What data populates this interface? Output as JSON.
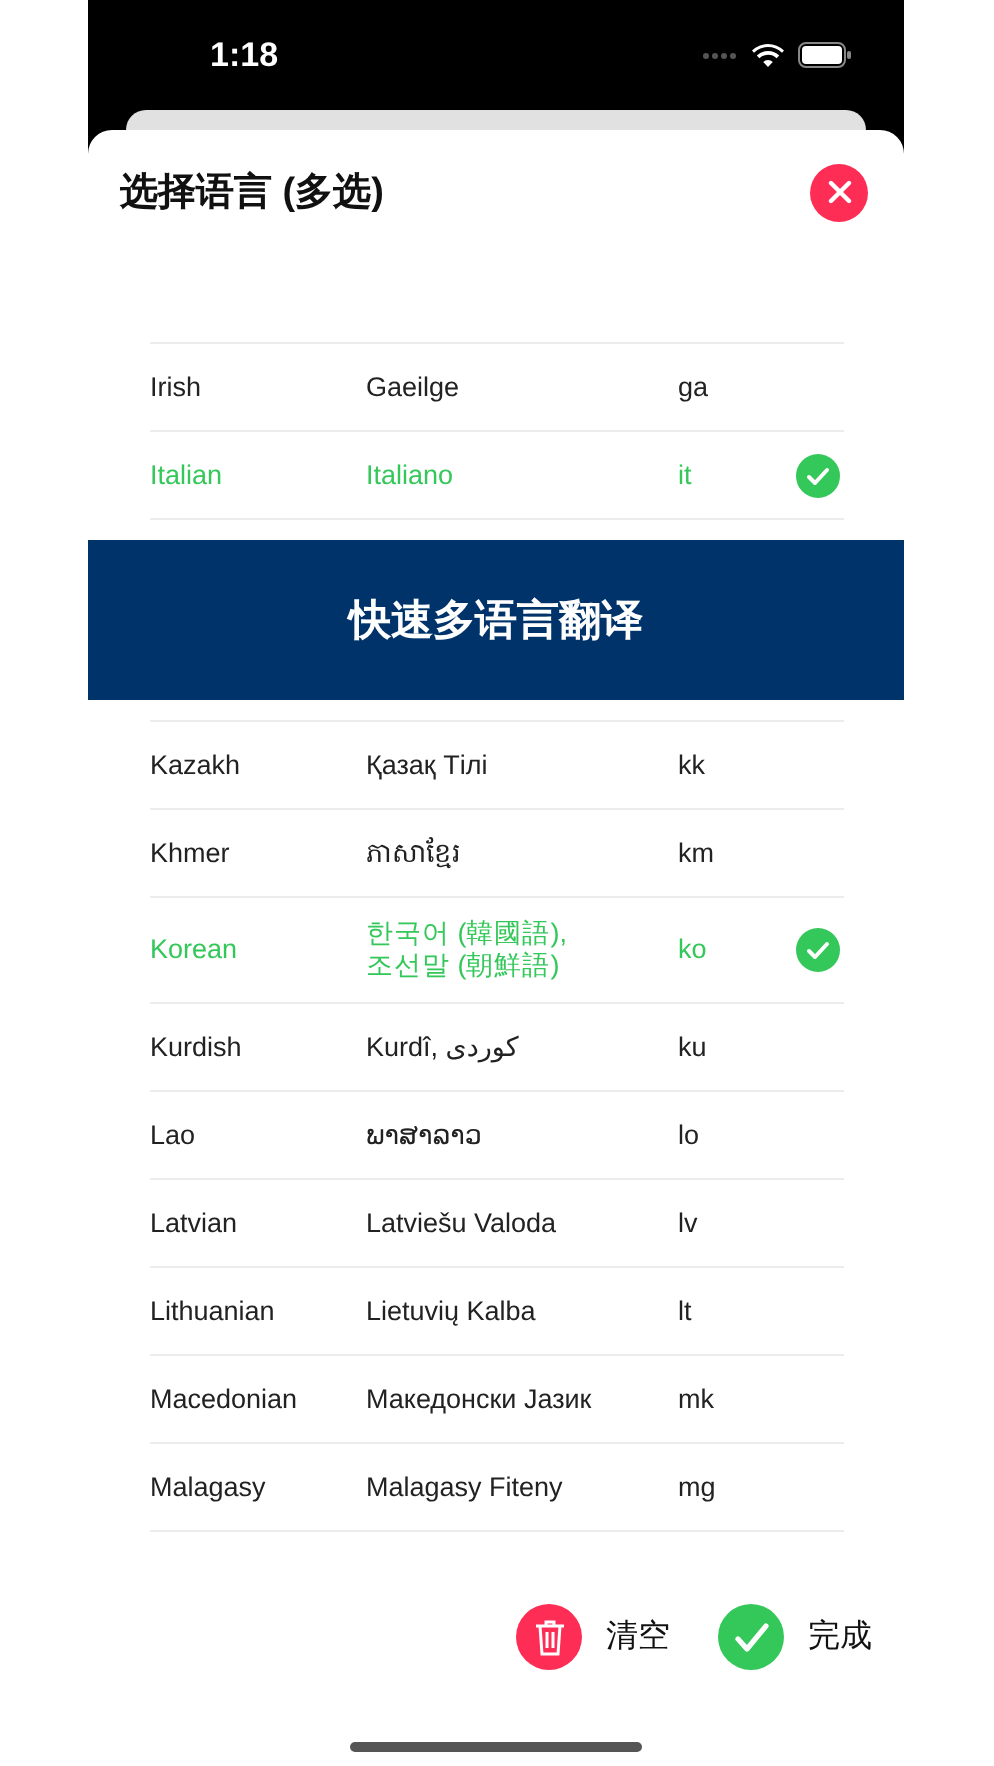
{
  "status_bar": {
    "time": "1:18"
  },
  "sheet": {
    "title": "选择语言 (多选)"
  },
  "languages_top": [
    {
      "name": "Irish",
      "native": "Gaeilge",
      "code": "ga",
      "selected": false
    },
    {
      "name": "Italian",
      "native": "Italiano",
      "code": "it",
      "selected": true
    }
  ],
  "banner": {
    "text": "快速多语言翻译"
  },
  "languages_bottom": [
    {
      "name": "Kazakh",
      "native": "Қазақ Тілі",
      "code": "kk",
      "selected": false
    },
    {
      "name": "Khmer",
      "native": "ភាសាខ្មែរ",
      "code": "km",
      "selected": false
    },
    {
      "name": "Korean",
      "native": "한국어 (韓國語),\n조선말 (朝鮮語)",
      "code": "ko",
      "selected": true
    },
    {
      "name": "Kurdish",
      "native": "Kurdî, كوردی",
      "code": "ku",
      "selected": false
    },
    {
      "name": "Lao",
      "native": "ພາສາລາວ",
      "code": "lo",
      "selected": false
    },
    {
      "name": "Latvian",
      "native": "Latviešu Valoda",
      "code": "lv",
      "selected": false
    },
    {
      "name": "Lithuanian",
      "native": "Lietuvių Kalba",
      "code": "lt",
      "selected": false
    },
    {
      "name": "Macedonian",
      "native": "Македонски Јазик",
      "code": "mk",
      "selected": false
    },
    {
      "name": "Malagasy",
      "native": "Malagasy Fiteny",
      "code": "mg",
      "selected": false
    }
  ],
  "actions": [
    {
      "kind": "clear",
      "label": "清空"
    },
    {
      "kind": "done",
      "label": "完成"
    }
  ]
}
